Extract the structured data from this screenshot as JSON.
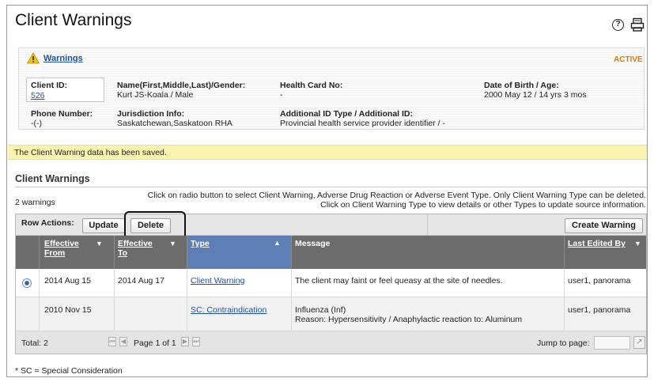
{
  "page": {
    "title": "Client Warnings"
  },
  "icons": {
    "help": "help-icon",
    "print": "print-icon",
    "warning": "warning-triangle-icon"
  },
  "colors": {
    "link": "#1d50a8",
    "active_badge": "#e07b00",
    "saved_bar": "#fbf3b0",
    "header_bg": "#6c6c6c",
    "selected_header": "#5d7fb6"
  },
  "client": {
    "warnings_link": "Warnings",
    "status": "ACTIVE",
    "client_id_label": "Client ID:",
    "client_id": "526",
    "name_label": "Name(First,Middle,Last)/Gender:",
    "name": "Kurt JS-Koala / Male",
    "health_card_label": "Health Card No:",
    "health_card": "-",
    "dob_label": "Date of Birth / Age:",
    "dob": "2000 May 12 / 14 yrs 3 mos",
    "phone_label": "Phone Number:",
    "phone": "-(-)",
    "jurisdiction_label": "Jurisdiction Info:",
    "jurisdiction": "Saskatchewan,Saskatoon RHA",
    "additional_id_label": "Additional ID Type / Additional ID:",
    "additional_id": "Provincial health service provider identifier / -"
  },
  "message": "The Client Warning data has been saved.",
  "section": {
    "title": "Client Warnings",
    "count": "2 warnings",
    "instructions_line1": "Click on radio button to select Client Warning, Adverse Drug Reaction or Adverse Event Type. Only Client Warning Type can be deleted.",
    "instructions_line2": "Click on Client Warning Type to view details or other Types to update source information."
  },
  "toolbar": {
    "row_actions_label": "Row Actions:",
    "update_label": "Update",
    "delete_label": "Delete",
    "create_label": "Create Warning"
  },
  "table": {
    "headers": {
      "effective_from_1": "Effective",
      "effective_from_2": "From",
      "effective_to_1": "Effective",
      "effective_to_2": "To",
      "type": "Type",
      "message": "Message",
      "last_edited": "Last Edited By"
    },
    "rows": [
      {
        "selected": true,
        "effective_from": "2014 Aug 15",
        "effective_to": "2014 Aug 17",
        "type": "Client Warning",
        "message": "The client may faint or feel queasy at the site of needles.",
        "message2": "",
        "last_edited": "user1, panorama"
      },
      {
        "selected": false,
        "effective_from": "2010 Nov 15",
        "effective_to": "",
        "type": "SC: Contraindication",
        "message": "Influenza (Inf)",
        "message2": "Reason: Hypersensitivity / Anaphylactic reaction to: Aluminum",
        "last_edited": "user1, panorama"
      }
    ]
  },
  "pager": {
    "total": "Total: 2",
    "page_text": "Page 1 of 1",
    "jump_label": "Jump to page:",
    "jump_value": ""
  },
  "footnote": "* SC = Special Consideration"
}
